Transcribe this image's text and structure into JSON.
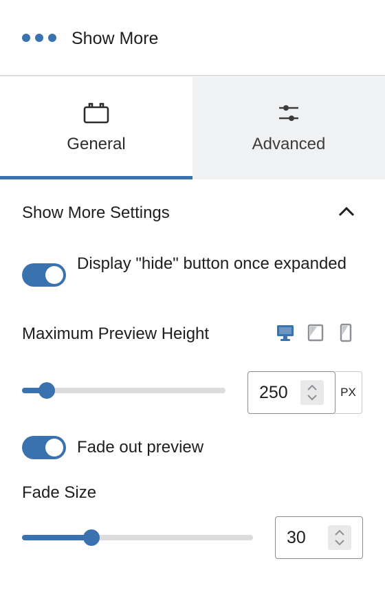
{
  "header": {
    "title": "Show More",
    "icon": "more-dots-icon"
  },
  "tabs": [
    {
      "label": "General",
      "icon": "toolbox-icon",
      "active": true
    },
    {
      "label": "Advanced",
      "icon": "sliders-icon",
      "active": false
    }
  ],
  "section": {
    "title": "Show More Settings",
    "expanded": true
  },
  "settings": {
    "hide_button_toggle": {
      "label": "Display \"hide\" button once expanded",
      "on": true
    },
    "max_preview_height": {
      "label": "Maximum Preview Height",
      "value": "250",
      "unit": "PX",
      "slider_fraction": 0.12,
      "devices": [
        "desktop-icon",
        "tablet-icon",
        "mobile-icon"
      ],
      "active_device": "desktop"
    },
    "fade_toggle": {
      "label": "Fade out preview",
      "on": true
    },
    "fade_size": {
      "label": "Fade Size",
      "value": "30",
      "slider_fraction": 0.3
    }
  },
  "colors": {
    "accent": "#3a72b0",
    "track": "#dcdcde",
    "tab_inactive_bg": "#f0f1f3"
  }
}
